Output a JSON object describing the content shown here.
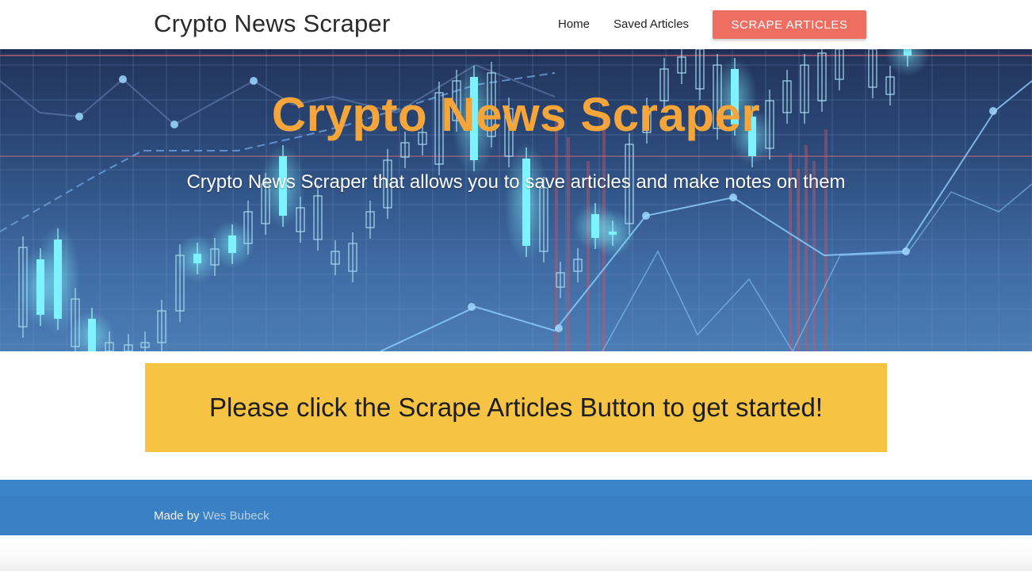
{
  "navbar": {
    "brand": "Crypto News Scraper",
    "links": [
      {
        "label": "Home"
      },
      {
        "label": "Saved Articles"
      }
    ],
    "scrape_button": "SCRAPE ARTICLES"
  },
  "hero": {
    "title": "Crypto News Scraper",
    "subtitle": "Crypto News Scraper that allows you to save articles and make notes on them",
    "background_image": "crypto-candlestick-chart-background"
  },
  "callout": {
    "message": "Please click the Scrape Articles Button to get started!"
  },
  "footer": {
    "made_by_prefix": "Made by",
    "author": "Wes Bubeck"
  },
  "colors": {
    "accent_button": "#ee6e62",
    "hero_title": "#f5a53a",
    "callout_bg": "#f6c343",
    "footer_bg": "#3a80c4"
  }
}
